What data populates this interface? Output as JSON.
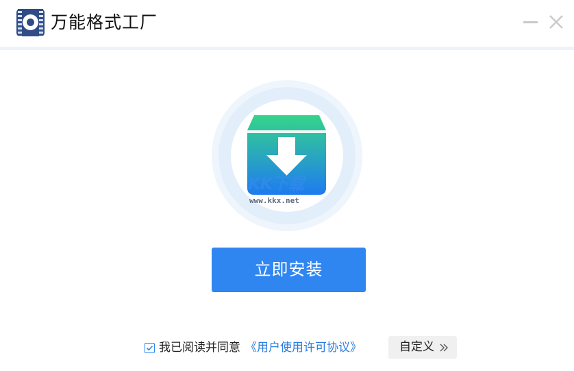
{
  "window": {
    "title": "万能格式工厂",
    "logo_icon": "format-factory-logo-icon",
    "controls": {
      "minimize_icon": "minimize-icon",
      "close_icon": "close-icon"
    }
  },
  "main": {
    "icon": "install-box-download-icon",
    "watermark": {
      "brand": "KK下载",
      "url": "www.kkx.net"
    },
    "install_button": "立即安装"
  },
  "footer": {
    "agree_checked": true,
    "agree_text": "我已阅读并同意",
    "license_link": "《用户使用许可协议》",
    "custom_button": "自定义"
  },
  "colors": {
    "accent": "#2f86f0",
    "link": "#2a7de1",
    "icon_gradient_top": "#35d48a",
    "icon_gradient_bottom": "#1e7bf0"
  }
}
